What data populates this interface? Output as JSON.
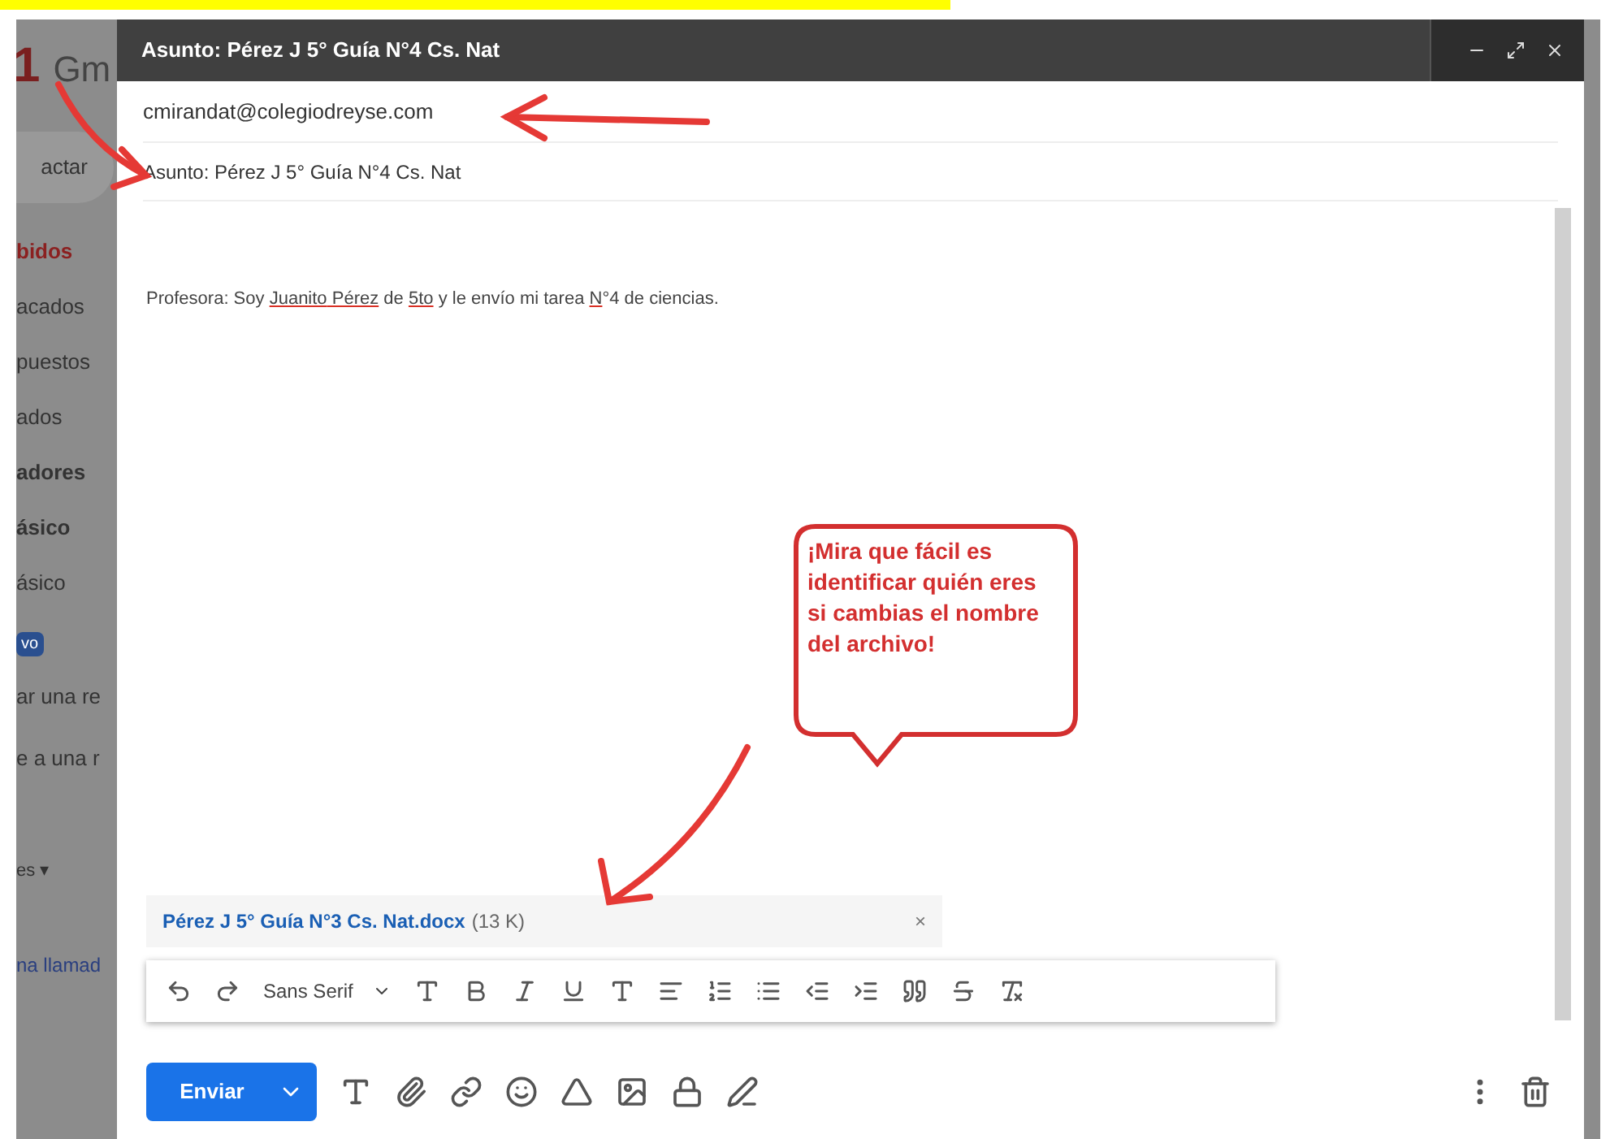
{
  "background": {
    "logo_digit": "1",
    "logo_text": "Gm",
    "compose_label": "actar",
    "folders": [
      {
        "label": "bidos",
        "selected": true,
        "bold": true
      },
      {
        "label": "acados",
        "selected": false,
        "bold": false
      },
      {
        "label": "puestos",
        "selected": false,
        "bold": false
      },
      {
        "label": "ados",
        "selected": false,
        "bold": false
      },
      {
        "label": "adores",
        "selected": false,
        "bold": true
      },
      {
        "label": "ásico",
        "selected": false,
        "bold": true
      },
      {
        "label": "ásico",
        "selected": false,
        "bold": false
      }
    ],
    "badge": "vo",
    "lines": [
      "ar una re",
      "e a una r"
    ],
    "more": "es ▾",
    "link": "na llamad"
  },
  "compose": {
    "title": "Asunto: Pérez J 5° Guía N°4 Cs. Nat",
    "to": "cmirandat@colegiodreyse.com",
    "subject": "Asunto: Pérez J 5° Guía N°4 Cs. Nat",
    "body": [
      {
        "text": "Profesora: Soy ",
        "misspelled": false
      },
      {
        "text": "Juanito",
        "misspelled": true
      },
      {
        "text": " Pérez",
        "misspelled": true
      },
      {
        "text": " de ",
        "misspelled": false
      },
      {
        "text": "5to",
        "misspelled": true
      },
      {
        "text": " y le envío mi tarea ",
        "misspelled": false
      },
      {
        "text": "N",
        "misspelled": true
      },
      {
        "text": "°4 de ciencias.",
        "misspelled": false
      }
    ],
    "attachment": {
      "name": "Pérez J 5° Guía N°3 Cs. Nat.docx",
      "size": "(13 K)",
      "close": "×"
    },
    "font": "Sans Serif",
    "send": "Enviar"
  },
  "callout": "¡Mira que fácil es identificar quién eres si cambias el nombre del archivo!"
}
